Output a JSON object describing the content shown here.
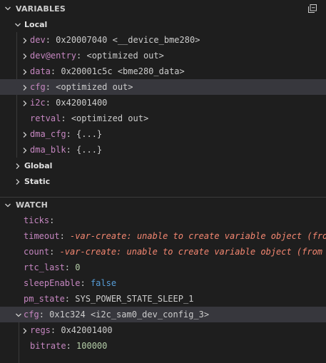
{
  "variables": {
    "title": "VARIABLES",
    "scopes": {
      "local": {
        "label": "Local",
        "items": [
          {
            "name": "dev",
            "value": "0x20007040 <__device_bme280>"
          },
          {
            "name": "dev@entry",
            "value": "<optimized out>"
          },
          {
            "name": "data",
            "value": "0x20001c5c <bme280_data>"
          },
          {
            "name": "cfg",
            "value": "<optimized out>"
          },
          {
            "name": "i2c",
            "value": "0x42001400"
          },
          {
            "name": "retval",
            "value": "<optimized out>"
          },
          {
            "name": "dma_cfg",
            "value": "{...}"
          },
          {
            "name": "dma_blk",
            "value": "{...}"
          }
        ]
      },
      "global": {
        "label": "Global"
      },
      "static": {
        "label": "Static"
      }
    }
  },
  "watch": {
    "title": "WATCH",
    "items": [
      {
        "name": "ticks",
        "value": ""
      },
      {
        "name": "timeout",
        "value": "-var-create: unable to create variable object (from v"
      },
      {
        "name": "count",
        "value": "-var-create: unable to create variable object (from var"
      },
      {
        "name": "rtc_last",
        "value": "0"
      },
      {
        "name": "sleepEnable",
        "value": "false"
      },
      {
        "name": "pm_state",
        "value": "SYS_POWER_STATE_SLEEP_1"
      },
      {
        "name": "cfg",
        "value": "0x1c324 <i2c_sam0_dev_config_3>"
      },
      {
        "name": "regs",
        "value": "0x42001400"
      },
      {
        "name": "bitrate",
        "value": "100000"
      }
    ]
  }
}
